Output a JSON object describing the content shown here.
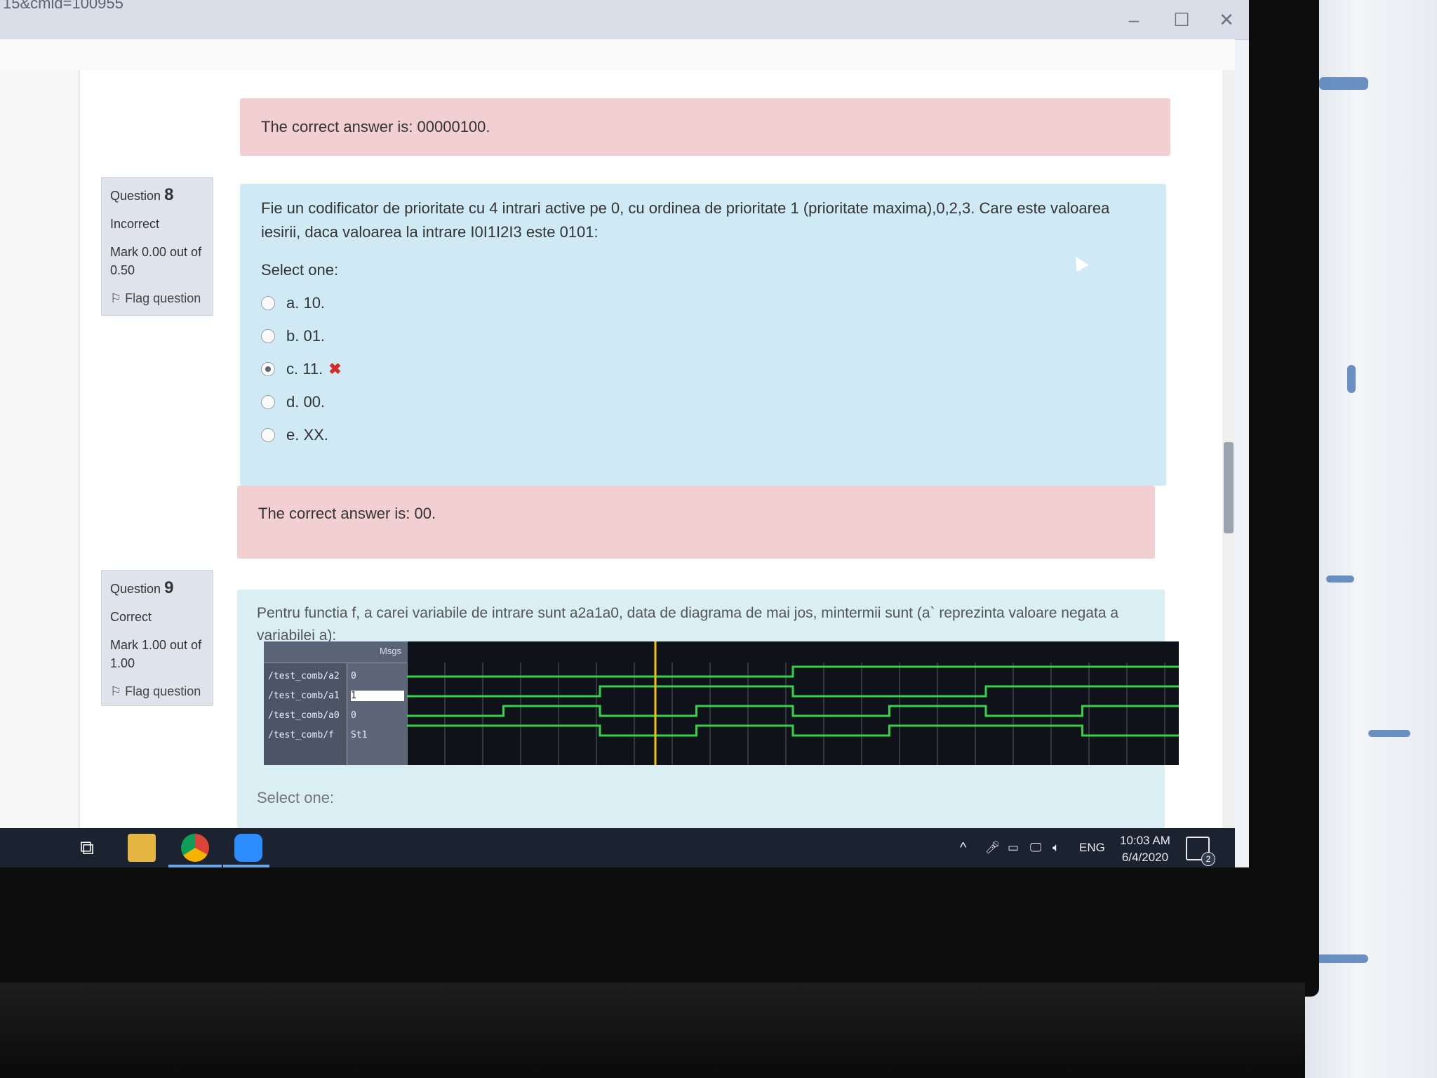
{
  "browser": {
    "url_fragment": "15&cmid=100955"
  },
  "q7_feedback": "The correct answer is: 00000100.",
  "q8": {
    "label": "Question",
    "number": "8",
    "state": "Incorrect",
    "mark": "Mark 0.00 out of 0.50",
    "flag": "Flag question",
    "text": "Fie un codificator de prioritate cu 4 intrari active pe 0, cu ordinea de prioritate 1 (prioritate maxima),0,2,3. Care este valoarea iesirii, daca valoarea la intrare I0I1I2I3 este 0101:",
    "select_one": "Select one:",
    "options": [
      {
        "label": "a. 10.",
        "selected": false
      },
      {
        "label": "b. 01.",
        "selected": false
      },
      {
        "label": "c. 11.",
        "selected": true,
        "mark": "✖"
      },
      {
        "label": "d. 00.",
        "selected": false
      },
      {
        "label": "e. XX.",
        "selected": false
      }
    ],
    "feedback": "The correct answer is: 00."
  },
  "q9": {
    "label": "Question",
    "number": "9",
    "state": "Correct",
    "mark": "Mark 1.00 out of 1.00",
    "flag": "Flag question",
    "text": "Pentru functia f, a carei variabile de intrare sunt a2a1a0, data de diagrama de mai jos, mintermii sunt (a` reprezinta valoare negata a variabilei a):",
    "select_one": "Select one:",
    "waveform": {
      "header_label": "Msgs",
      "signals": [
        {
          "name": "/test_comb/a2",
          "value": "0"
        },
        {
          "name": "/test_comb/a1",
          "value": "1"
        },
        {
          "name": "/test_comb/a0",
          "value": "0"
        },
        {
          "name": "/test_comb/f",
          "value": "St1"
        }
      ],
      "trace_color": "#33d24a",
      "cursor_color": "#f2c21a"
    }
  },
  "taskbar": {
    "lang": "ENG",
    "time": "10:03 AM",
    "date": "6/4/2020",
    "notifications": "2"
  },
  "colors": {
    "feedback_bg": "#f2cfd0",
    "question_bg": "#cfeaf5",
    "info_bg": "#dfe4ec"
  }
}
